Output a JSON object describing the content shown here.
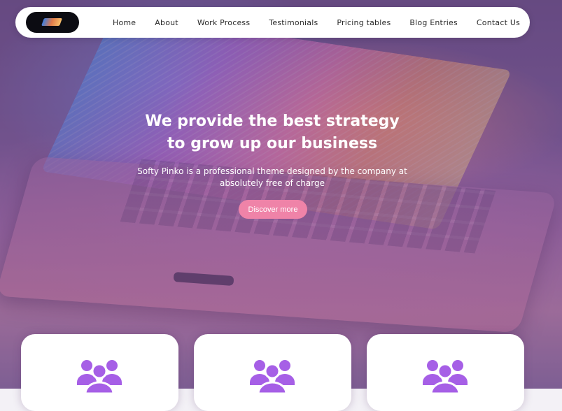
{
  "nav": {
    "logo_alt": "logo",
    "links": [
      "Home",
      "About",
      "Work Process",
      "Testimonials",
      "Pricing tables",
      "Blog Entries",
      "Contact Us"
    ]
  },
  "hero": {
    "title_line1": "We provide the best strategy",
    "title_line2": "to grow up our business",
    "subtitle_line1": "Softy Pinko is a professional theme designed by the company at",
    "subtitle_line2": "absolutely free of charge",
    "cta_label": "Discover more"
  },
  "features": {
    "cards": [
      {
        "icon": "users-icon"
      },
      {
        "icon": "users-icon"
      },
      {
        "icon": "users-icon"
      }
    ],
    "icon_color": "#a65fe6"
  },
  "colors": {
    "accent": "#ef83a8",
    "nav_bg": "#ffffff",
    "icon": "#a65fe6"
  }
}
